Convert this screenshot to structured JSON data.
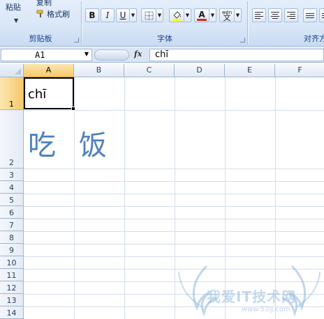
{
  "ribbon": {
    "clipboard": {
      "paste_label": "粘贴",
      "copy_label": "复制",
      "format_painter_label": "格式刷",
      "group_label": "剪贴板"
    },
    "font": {
      "bold_label": "B",
      "italic_label": "I",
      "underline_label": "U",
      "font_color_label": "A",
      "phonetic_label": "wén",
      "phonetic_char": "文",
      "group_label": "字体"
    },
    "alignment": {
      "group_label": "对齐方"
    }
  },
  "formula_bar": {
    "name_box": "A1",
    "fx_label": "fx",
    "formula_value": "chī"
  },
  "columns": [
    "A",
    "B",
    "C",
    "D",
    "E",
    "F"
  ],
  "rows": [
    "1",
    "2",
    "3",
    "4",
    "5",
    "6",
    "7",
    "8",
    "9",
    "10",
    "11",
    "12",
    "13",
    "14"
  ],
  "cells": {
    "a1": "chī",
    "a2": "吃",
    "b2": "饭"
  },
  "watermark": {
    "text": "我爱IT技术网",
    "url": "www.52ij.com"
  },
  "colors": {
    "ribbon_bg": "#d8e6f7",
    "selected_header": "#f7c96b",
    "cell_text_blue": "#4f81bd",
    "font_color_red": "#e0261b",
    "fill_yellow": "#ffff00"
  }
}
